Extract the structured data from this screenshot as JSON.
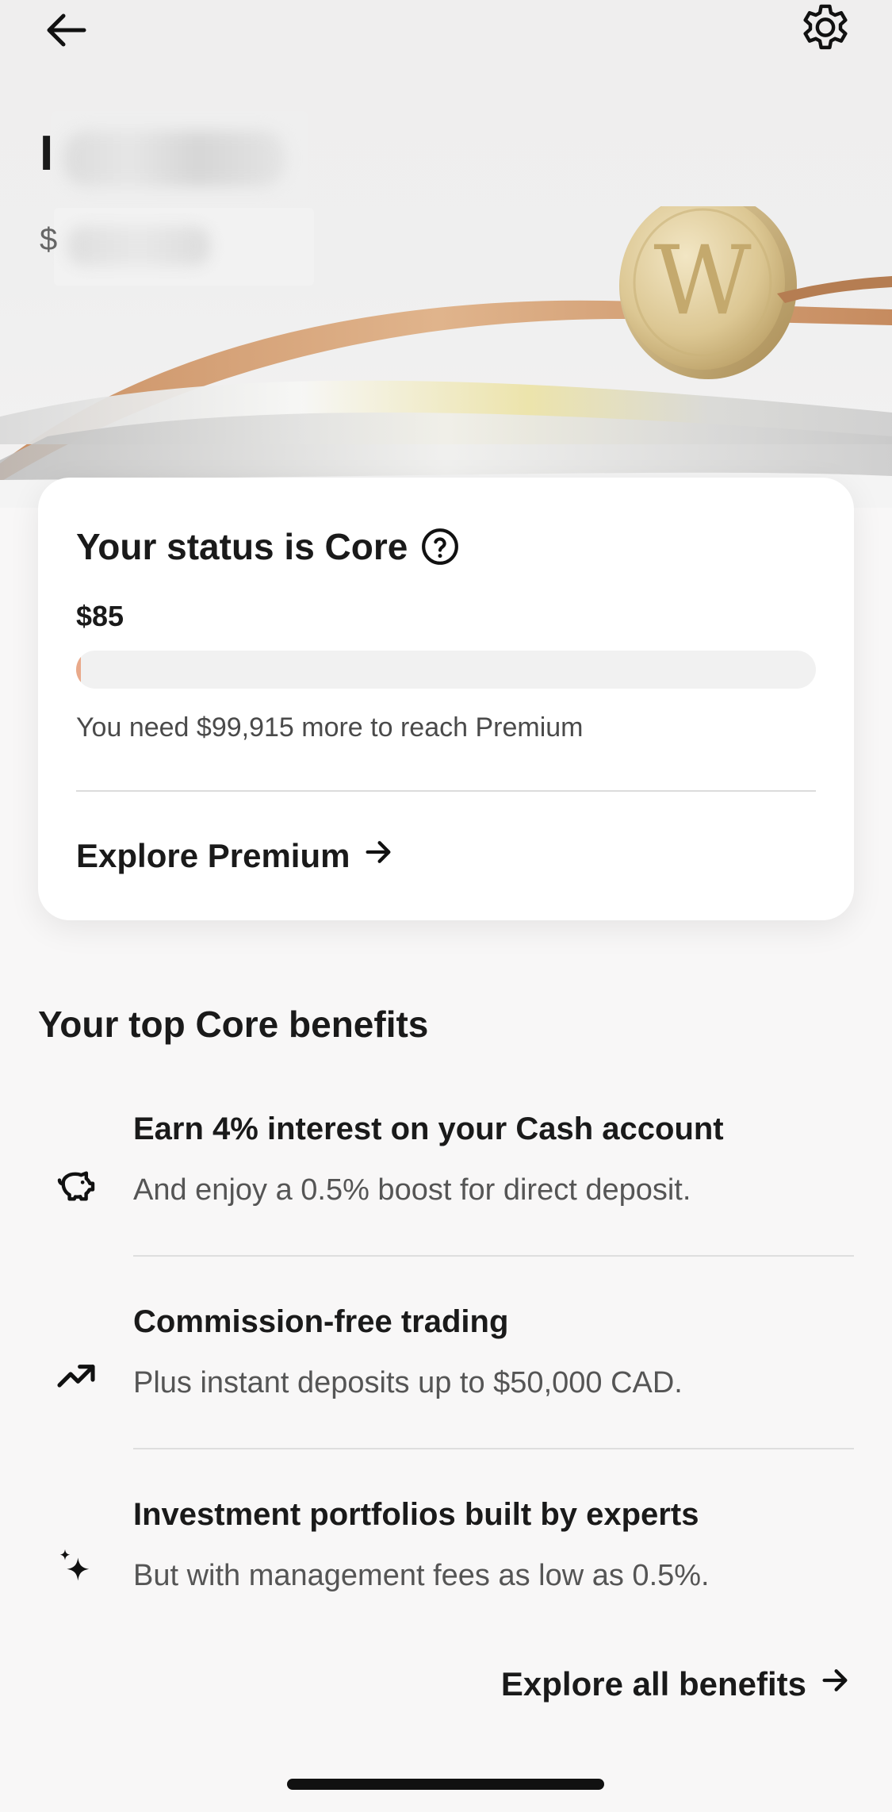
{
  "header": {
    "back_icon": "arrow-left-icon",
    "settings_icon": "gear-icon"
  },
  "account": {
    "name_initial": "I",
    "balance_prefix": "$"
  },
  "status_card": {
    "title": "Your status is Core",
    "help_icon": "question-circle-icon",
    "amount": "$85",
    "progress_fraction": 0.00085,
    "progress_color": "#e9a98a",
    "note": "You need $99,915 more to reach Premium",
    "link_label": "Explore Premium"
  },
  "benefits": {
    "title": "Your top Core benefits",
    "items": [
      {
        "icon": "piggy-bank-icon",
        "title": "Earn 4% interest on your Cash account",
        "description": "And enjoy a 0.5% boost for direct deposit."
      },
      {
        "icon": "trending-up-icon",
        "title": "Commission-free trading",
        "description": "Plus instant deposits up to $50,000 CAD."
      },
      {
        "icon": "sparkle-icon",
        "title": "Investment portfolios built by experts",
        "description": "But with management fees as low as 0.5%."
      }
    ],
    "link_label": "Explore all benefits"
  },
  "branding": {
    "coin_letter": "W",
    "coin_color": "#d8c28f"
  }
}
